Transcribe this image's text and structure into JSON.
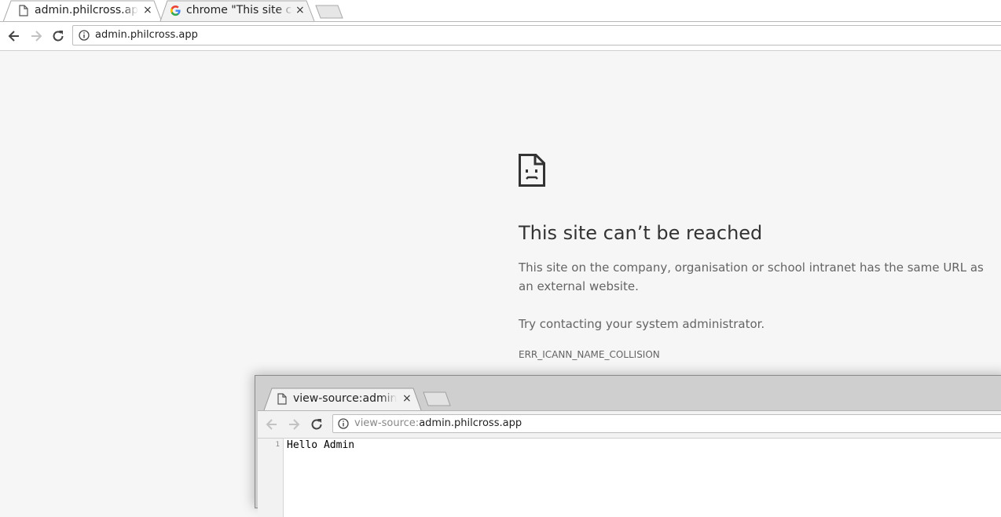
{
  "main_window": {
    "tabs": [
      {
        "title": "admin.philcross.app",
        "icon": "page-icon",
        "close": "×"
      },
      {
        "title": "chrome \"This site can't be reached\"",
        "icon": "google-icon",
        "close": "×"
      }
    ],
    "url": "admin.philcross.app"
  },
  "error_page": {
    "icon": "sad-page-icon",
    "heading": "This site can’t be reached",
    "paragraph": "This site on the company, organisation or school intranet has the same URL as an external website.",
    "suggestion": "Try contacting your system administrator.",
    "code": "ERR_ICANN_NAME_COLLISION"
  },
  "source_window": {
    "tab": {
      "title": "view-source:admin.philcross.app",
      "icon": "page-icon",
      "close": "×"
    },
    "url_scheme": "view-source:",
    "url_host": "admin.philcross.app",
    "lines": [
      {
        "number": "1",
        "text": "Hello Admin"
      }
    ]
  },
  "colors": {
    "page_background": "#f6f6f6",
    "heading": "#333333",
    "body_text": "#646464"
  }
}
